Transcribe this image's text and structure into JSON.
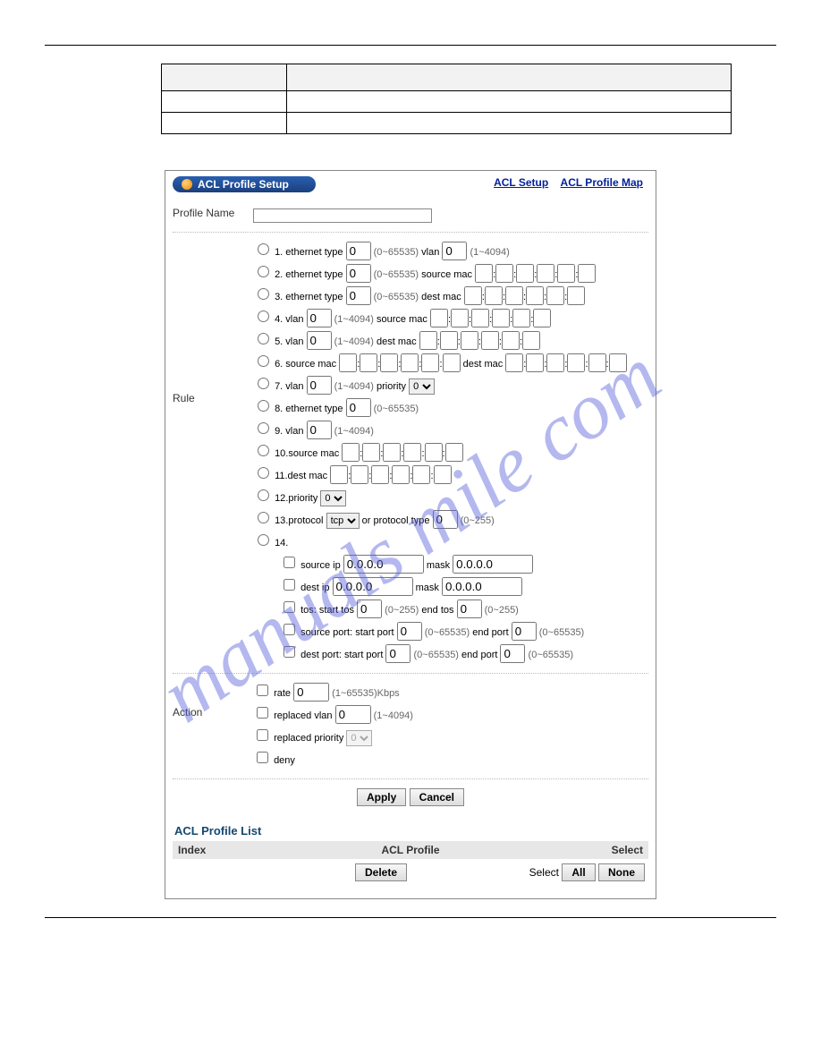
{
  "watermark": "manuals mile com",
  "top_table": {},
  "panel": {
    "title": "ACL Profile Setup",
    "links": {
      "setup": "ACL Setup",
      "map": "ACL Profile Map"
    }
  },
  "profile_name": {
    "label": "Profile Name",
    "value": ""
  },
  "rule": {
    "label": "Rule",
    "r1": {
      "pre": "1. ethernet type",
      "v": "0",
      "hint": "(0~65535)",
      "vlan_l": "vlan",
      "vlan_v": "0",
      "vlan_hint": "(1~4094)"
    },
    "r2": {
      "pre": "2. ethernet type",
      "v": "0",
      "hint": "(0~65535)",
      "mac_l": "source mac"
    },
    "r3": {
      "pre": "3. ethernet type",
      "v": "0",
      "hint": "(0~65535)",
      "mac_l": "dest mac"
    },
    "r4": {
      "pre": "4. vlan",
      "v": "0",
      "hint": "(1~4094)",
      "mac_l": "source mac"
    },
    "r5": {
      "pre": "5. vlan",
      "v": "0",
      "hint": "(1~4094)",
      "mac_l": "dest mac"
    },
    "r6": {
      "pre": "6. source mac",
      "mid": "dest mac"
    },
    "r7": {
      "pre": "7. vlan",
      "v": "0",
      "hint": "(1~4094)",
      "prio_l": "priority",
      "prio_v": "0"
    },
    "r8": {
      "pre": "8. ethernet type",
      "v": "0",
      "hint": "(0~65535)"
    },
    "r9": {
      "pre": "9. vlan",
      "v": "0",
      "hint": "(1~4094)"
    },
    "r10": {
      "pre": "10.source mac"
    },
    "r11": {
      "pre": "11.dest mac"
    },
    "r12": {
      "pre": "12.priority",
      "v": "0"
    },
    "r13": {
      "pre": "13.protocol",
      "sel": "tcp",
      "mid": "or protocol type",
      "v": "0",
      "hint": "(0~255)"
    },
    "r14": {
      "pre": "14.",
      "sip_l": "source ip",
      "sip_v": "0.0.0.0",
      "mask_l": "mask",
      "sip_mask": "0.0.0.0",
      "dip_l": "dest ip",
      "dip_v": "0.0.0.0",
      "dip_mask": "0.0.0.0",
      "tos_l": "tos: start tos",
      "tos_s": "0",
      "tos_h1": "(0~255)",
      "tos_e_l": "end tos",
      "tos_e": "0",
      "tos_h2": "(0~255)",
      "sp_l": "source port: start port",
      "sp_s": "0",
      "sp_h1": "(0~65535)",
      "sp_e_l": "end port",
      "sp_e": "0",
      "sp_h2": "(0~65535)",
      "dp_l": "dest port: start port",
      "dp_s": "0",
      "dp_h1": "(0~65535)",
      "dp_e_l": "end port",
      "dp_e": "0",
      "dp_h2": "(0~65535)"
    }
  },
  "action": {
    "label": "Action",
    "rate_l": "rate",
    "rate_v": "0",
    "rate_hint": "(1~65535)Kbps",
    "rvlan_l": "replaced vlan",
    "rvlan_v": "0",
    "rvlan_hint": "(1~4094)",
    "rprio_l": "replaced priority",
    "rprio_v": "0",
    "deny_l": "deny"
  },
  "buttons": {
    "apply": "Apply",
    "cancel": "Cancel",
    "delete": "Delete",
    "all": "All",
    "none": "None"
  },
  "list": {
    "title": "ACL Profile List",
    "col_index": "Index",
    "col_profile": "ACL Profile",
    "col_select": "Select",
    "select_l": "Select"
  }
}
